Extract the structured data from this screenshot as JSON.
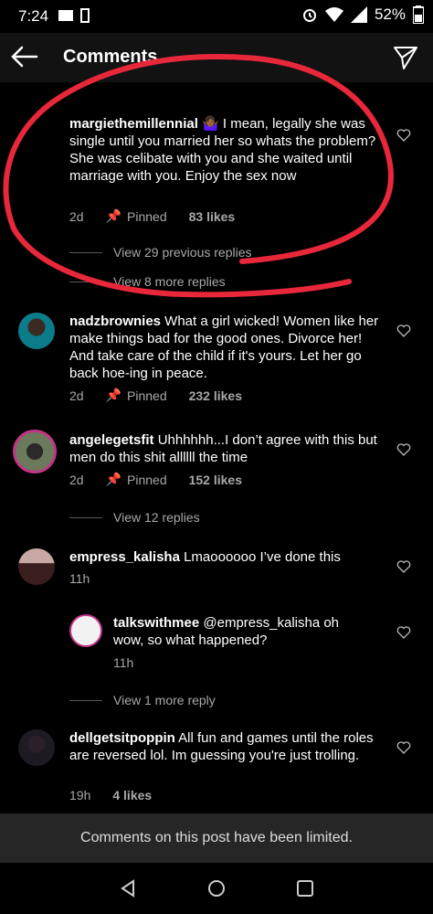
{
  "status": {
    "time": "7:24",
    "battery": "52%"
  },
  "header": {
    "title": "Comments"
  },
  "comments": [
    {
      "user": "margiethemillennial",
      "emoji": "🤷🏾‍♀️",
      "text": " I mean, legally she was single until you married her so whats the problem? She was celibate with you and she waited until marriage with you. Enjoy the sex now",
      "age": "2d",
      "pinned": "Pinned",
      "likes": "83 likes"
    },
    {
      "user": "nadzbrownies",
      "text": " What a girl wicked! Women like her make things bad for the good ones. Divorce her! And take care of the child if it's yours. Let her go back hoe-ing in peace.",
      "age": "2d",
      "pinned": "Pinned",
      "likes": "232 likes"
    },
    {
      "user": "angelegetsfit",
      "text": " Uhhhhhh...I don’t agree with this but men do this shit allllll the time",
      "age": "2d",
      "pinned": "Pinned",
      "likes": "152 likes"
    },
    {
      "user": "empress_kalisha",
      "text": " Lmaoooooo I’ve done this",
      "age": "11h"
    },
    {
      "user": "talkswithmee",
      "text": " @empress_kalisha oh wow, so what happened?",
      "age": "11h"
    },
    {
      "user": "dellgetsitpoppin",
      "text": " All fun and games until the roles are reversed lol. Im guessing you're just trolling.",
      "age": "19h",
      "likes": "4 likes"
    }
  ],
  "threads": {
    "previous": "View 29 previous replies",
    "more8": "View 8 more replies",
    "more12": "View 12 replies",
    "more1": "View 1 more reply"
  },
  "footer": {
    "limited": "Comments on this post have been limited."
  },
  "colors": {
    "annotation": "#e8283a",
    "background": "#000000",
    "meta": "#a8a8a8"
  }
}
